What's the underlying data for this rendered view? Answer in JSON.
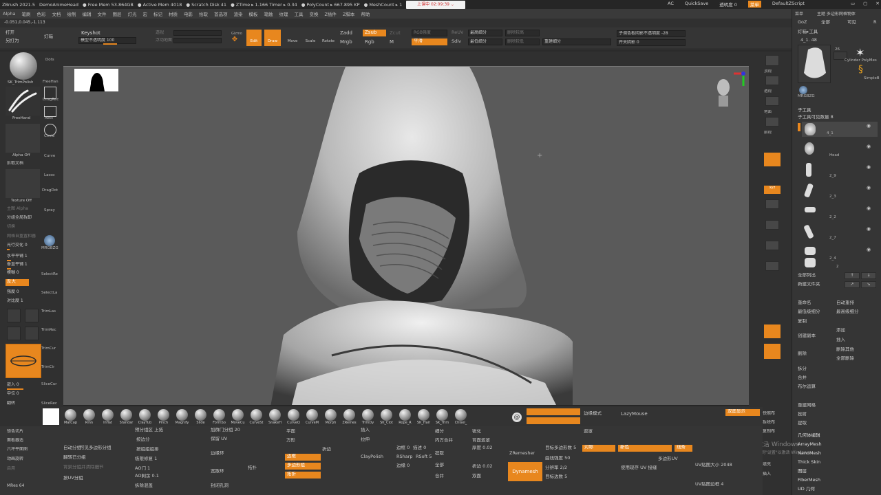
{
  "titlebar": {
    "items": [
      "ZBrush 2021.5",
      "DemoAnimeHead",
      "● Free Mem 53.864GB",
      "● Active Mem 4018",
      "● Scratch Disk 41",
      "● ZTime ▸ 1.166 Timer ▸ 0.34",
      "● PolyCount ▸ 667.895 KP",
      "● MeshCount ▸ 1"
    ],
    "timer": "上课中 02:09:39 ⌄",
    "right": [
      "AC",
      "QuickSave",
      "透明度 0",
      "菜单",
      "DefaultZScript"
    ]
  },
  "menubar": [
    "Alpha",
    "笔刷",
    "色彩",
    "文档",
    "绘制",
    "编辑",
    "文件",
    "图层",
    "灯光",
    "宏",
    "标记",
    "材质",
    "电影",
    "拾取",
    "首选项",
    "渲染",
    "模板",
    "笔触",
    "纹理",
    "工具",
    "变换",
    "Z插件",
    "Z脚本",
    "帮助"
  ],
  "coords": "-0.051,0.045,-1.113",
  "top": {
    "left_labels": [
      "打开",
      "另打为",
      "灯箱"
    ],
    "keyshot": "Keyshot",
    "keyshot_sub": "模型不透明度 100",
    "mode_labels": [
      "透视",
      "浮动地面",
      "Gizmo"
    ],
    "edit_label": "Edit",
    "draw_label": "Draw",
    "move_label": "Move",
    "scale_label": "Scale",
    "rotate_label": "Rotate",
    "zadd": "Zadd",
    "zsub": "Zsub",
    "zcut": "Zcut",
    "mrgb": "Mrgb",
    "rgb": "Rgb",
    "m": "M",
    "rgb_intensity": "RGB强度",
    "z_intensity": "平滑",
    "reuv": "ReUV",
    "sdiv": "Sdiv",
    "fields": [
      "最高细分",
      "最低细分",
      "删除较高",
      "删除较低",
      "重建细分"
    ],
    "right_fields": [
      "子调色板阴影不透明度 -28",
      "开关阴影 0"
    ]
  },
  "left": {
    "brush_name": "SK_TrimPolish",
    "stroke_name": "FreeHand",
    "alpha_name": "Alpha Off",
    "alpha_sub": "拆取文档",
    "texture_name": "Texture Off",
    "texture_sub": "主图 Alpha",
    "list": [
      "分组全局拆卸",
      "切换",
      "网格自重置和器",
      "光行交化 0",
      "水平平铺 1",
      "垂直平铺 1",
      "模糊 0",
      "反大",
      "强度 0",
      "对比度 1"
    ],
    "bottom": [
      "嵌入 0",
      "中位 0",
      "翻转"
    ],
    "bottom2": [
      "锁色切片",
      "面板器适",
      "六坪平面图",
      "动画旋转",
      "启用"
    ],
    "mesh_label": "MRes 64"
  },
  "tools_col": [
    "Dots",
    "FreeHan",
    "DragRec",
    "Rect",
    "Circle",
    "Curve",
    "Lasso",
    "DragDot",
    "Spray",
    "MRGBZG",
    "SelectRe",
    "SelectLa",
    "TrimLas",
    "TrimRec",
    "TrimCur",
    "TrimCir",
    "SliceCur",
    "SliceRec"
  ],
  "brushes": [
    "MatCap",
    "Rinn",
    "Inflat",
    "Standar",
    "ClayTub",
    "Pinch",
    "Magnify",
    "Slide",
    "FormSo",
    "MoveCu",
    "CurveSt",
    "SnakeH",
    "CurveQ",
    "CurveM",
    "Morph",
    "ZRemes",
    "TrimDy",
    "SK_Clot",
    "Rope_R",
    "SK_Hair",
    "SK_Trim",
    "Chisel_"
  ],
  "bottom_panel": {
    "col1": [
      "自动分组",
      "翻转已分组",
      "背景分组并清除细节",
      "按UV分组",
      "拆除拆分空间"
    ],
    "col1b": [
      "可见多边形分组",
      "按材质拆分",
      "按组组填填充",
      "AO剩余 0.1",
      "拆除混盖"
    ],
    "col2": [
      "预分组区 上拓",
      "按边分",
      "按组组组排",
      "极限修复 1",
      "AO门 1"
    ],
    "col3": [
      "加群门分组 20",
      "保留 UV",
      "边缘环",
      "宽散环",
      "封闭孔洞"
    ],
    "col4": [
      "拓扑",
      "光滑",
      "移除",
      "交叉",
      "转角"
    ],
    "col5": [
      "平面",
      "方形",
      "曲面",
      "拓扑",
      "拓展"
    ],
    "orange_buttons": [
      "边框",
      "多边形组",
      "拓折"
    ],
    "misc": [
      "插入",
      "拉伸",
      "折边",
      "ClayPolish",
      "边框 0",
      "RSharp",
      "RSoft 5",
      "边缘 0",
      "描述 0"
    ],
    "col6": [
      "细分",
      "内方合并",
      "提取",
      "全部",
      "合并"
    ],
    "col7": [
      "锐化",
      "背面遮罩",
      "厚度 0.02",
      "折边 0.02",
      "双面"
    ],
    "zremesher": "ZRemesher",
    "dynamesh": "Dynamesh",
    "col8": [
      "目标多边形数 5",
      "曲线强度 50",
      "分辨率 2/2",
      "目标边数 5"
    ],
    "col9": [
      "边缘模式",
      "对称",
      "遮罩",
      "新色",
      "线条"
    ],
    "lazymouse": "LazyMouse",
    "uv": [
      "多边形UV",
      "使用现存 UV 接缝",
      "UV贴图大小 2048",
      "UV贴图边框 4"
    ],
    "double_sided": "双面显示",
    "right_cols": [
      "快照布",
      "拆除布",
      "复制布",
      "填充",
      "插入"
    ]
  },
  "right_panel": {
    "top": [
      "菜单",
      "主题 多边形网格物体",
      "GoZ",
      "全部",
      "可见",
      "R"
    ],
    "light": "灯箱▸工具",
    "tool_name": "4_1. 48",
    "thumbs": [
      "26",
      "Cylinder PolyMes",
      "SimpleB",
      "MRGBZG"
    ],
    "subtool_header": "子工具",
    "subtool_count": "子工具可见数量 8",
    "subtools": [
      {
        "name": "4_1",
        "num": ""
      },
      {
        "name": "Head",
        "num": ""
      },
      {
        "name": "2_9",
        "num": ""
      },
      {
        "name": "2_3",
        "num": ""
      },
      {
        "name": "2_2",
        "num": ""
      },
      {
        "name": "2_7",
        "num": ""
      },
      {
        "name": "2_4",
        "num": ""
      },
      {
        "name": "2",
        "num": ""
      }
    ],
    "list_ops": [
      "全部列出",
      "新建文件夹"
    ],
    "ops": [
      "重命名",
      "自动重排",
      "最低级细分",
      "最高级细分",
      "复制",
      "添加",
      "创建副本",
      "插入",
      "删除",
      "删除其他",
      "全部删除"
    ],
    "split": "拆分",
    "merge": "合并",
    "boolean": "布尔运算",
    "remesh": "重建网格",
    "project": "投射",
    "extract": "提取",
    "fiber": [
      "几何体编辑",
      "ArrayMesh",
      "NanoMesh",
      "Thick Skin",
      "图层",
      "FiberMesh",
      "UD 几何"
    ],
    "watermark": "激活 Windows",
    "watermark_sub": "转到\"设置\"以激活 Windows。"
  },
  "viewport_icons": [
    "顶视",
    "透视",
    "地面",
    "前视",
    "正视",
    "远景",
    "放大",
    "缩放",
    "移动",
    "旋转",
    "图钉",
    "线框"
  ]
}
